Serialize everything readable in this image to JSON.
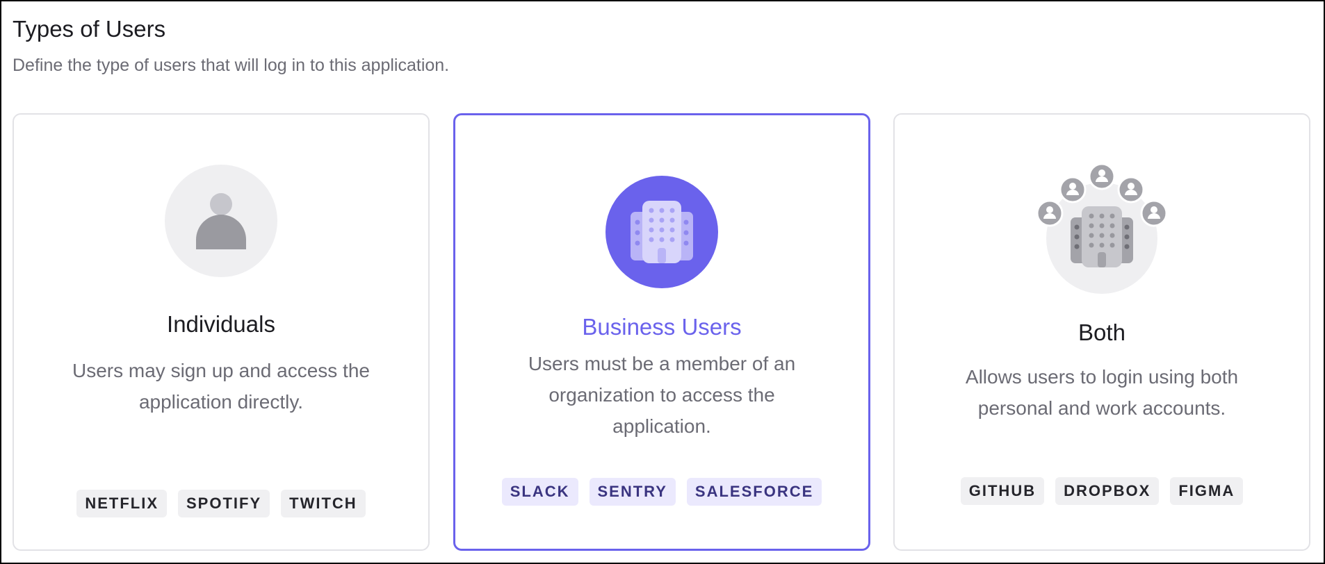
{
  "header": {
    "title": "Types of Users",
    "subtitle": "Define the type of users that will log in to this application."
  },
  "cards": [
    {
      "title": "Individuals",
      "description": "Users may sign up and access the application directly.",
      "icon": "person-icon",
      "selected": false,
      "badges": [
        "NETFLIX",
        "SPOTIFY",
        "TWITCH"
      ]
    },
    {
      "title": "Business Users",
      "description": "Users must be a member of an organization to access the application.",
      "icon": "building-icon",
      "selected": true,
      "badges": [
        "SLACK",
        "SENTRY",
        "SALESFORCE"
      ]
    },
    {
      "title": "Both",
      "description": "Allows users to login using both personal and work accounts.",
      "icon": "building-with-people-icon",
      "selected": false,
      "badges": [
        "GITHUB",
        "DROPBOX",
        "FIGMA"
      ]
    }
  ],
  "colors": {
    "accent": "#6a62ec",
    "accent_badge_bg": "#ebe9fd",
    "accent_badge_text": "#3a3480",
    "neutral_badge_bg": "#f0f0f2",
    "card_border": "#e2e2e6",
    "muted_text": "#6b6b74",
    "icon_gray": "#9a9aa0",
    "icon_bg_gray": "#efeff1"
  }
}
